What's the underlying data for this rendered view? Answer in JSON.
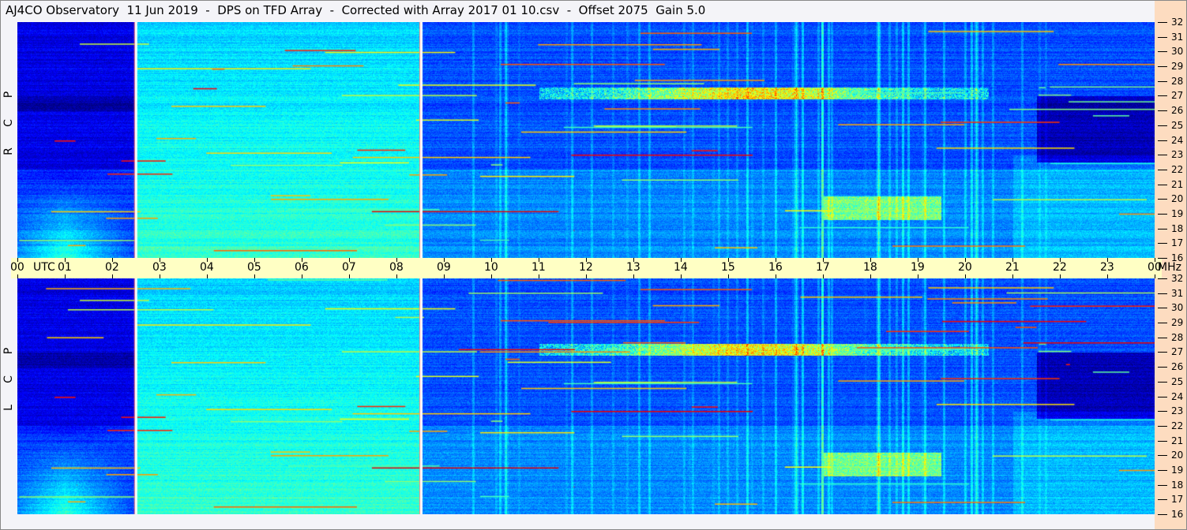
{
  "title": "AJ4CO Observatory  11 Jun 2019  -  DPS on TFD Array  -  Corrected with Array 2017 01 10.csv  -  Offset 2075  Gain 5.0",
  "chart_data": {
    "type": "heatmap",
    "colormap": "jet",
    "xlabel": "UTC",
    "ylabel": "MHz",
    "xlim": [
      0,
      24
    ],
    "ylim": [
      16,
      32
    ],
    "x_ticks": [
      "00",
      "01",
      "02",
      "03",
      "04",
      "05",
      "06",
      "07",
      "08",
      "09",
      "10",
      "11",
      "12",
      "13",
      "14",
      "15",
      "16",
      "17",
      "18",
      "19",
      "20",
      "21",
      "22",
      "23",
      "00"
    ],
    "y_ticks": [
      "16",
      "17",
      "18",
      "19",
      "20",
      "21",
      "22",
      "23",
      "24",
      "25",
      "26",
      "27",
      "28",
      "29",
      "30",
      "31",
      "32"
    ],
    "panels": [
      {
        "name": "RCP",
        "letters": [
          "R",
          "C",
          "P"
        ]
      },
      {
        "name": "LCP",
        "letters": [
          "L",
          "C",
          "P"
        ]
      }
    ],
    "gap_markers_utc": [
      2.48,
      8.5
    ],
    "features": [
      {
        "utc": [
          11,
          20.5
        ],
        "mhz": [
          26.8,
          27.6
        ],
        "level": "high"
      },
      {
        "utc": [
          17,
          19.5
        ],
        "mhz": [
          18.6,
          20.2
        ],
        "level": "medium"
      },
      {
        "utc": [
          0,
          2
        ],
        "mhz": [
          16,
          21
        ],
        "level": "medium"
      }
    ]
  }
}
